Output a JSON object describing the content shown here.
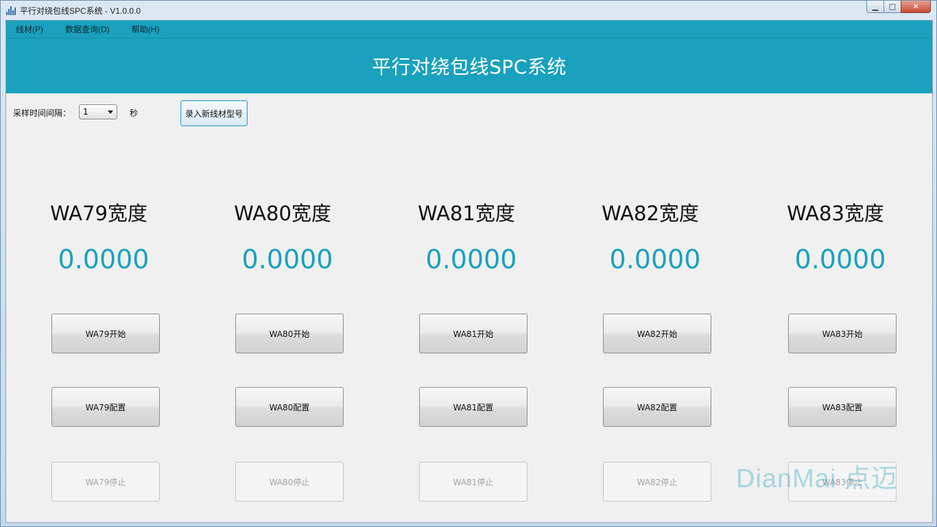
{
  "window": {
    "title": "平行对绕包线SPC系统 - V1.0.0.0",
    "controls": {
      "minimize": "▁",
      "maximize": "□",
      "close": "✕"
    }
  },
  "menu": [
    "线材(P)",
    "数据查询(D)",
    "帮助(H)"
  ],
  "banner": {
    "title": "平行对绕包线SPC系统"
  },
  "toolbar": {
    "interval_label": "采样时间间隔：",
    "interval_value": "1",
    "seconds_label": "秒",
    "new_type_button": "录入新线材型号"
  },
  "stations": [
    {
      "title": "WA79宽度",
      "value": "0.0000",
      "start": "WA79开始",
      "config": "WA79配置",
      "stop": "WA79停止"
    },
    {
      "title": "WA80宽度",
      "value": "0.0000",
      "start": "WA80开始",
      "config": "WA80配置",
      "stop": "WA80停止"
    },
    {
      "title": "WA81宽度",
      "value": "0.0000",
      "start": "WA81开始",
      "config": "WA81配置",
      "stop": "WA81停止"
    },
    {
      "title": "WA82宽度",
      "value": "0.0000",
      "start": "WA82开始",
      "config": "WA82配置",
      "stop": "WA82停止"
    },
    {
      "title": "WA83宽度",
      "value": "0.0000",
      "start": "WA83开始",
      "config": "WA83配置",
      "stop": "WA83停止"
    }
  ],
  "watermark": "DianMai 点迈",
  "colors": {
    "accent": "#1aa1bd",
    "value_text": "#1aa1bd"
  },
  "icons": {
    "app": "chart-bars-icon",
    "dropdown": "chevron-down-icon"
  }
}
